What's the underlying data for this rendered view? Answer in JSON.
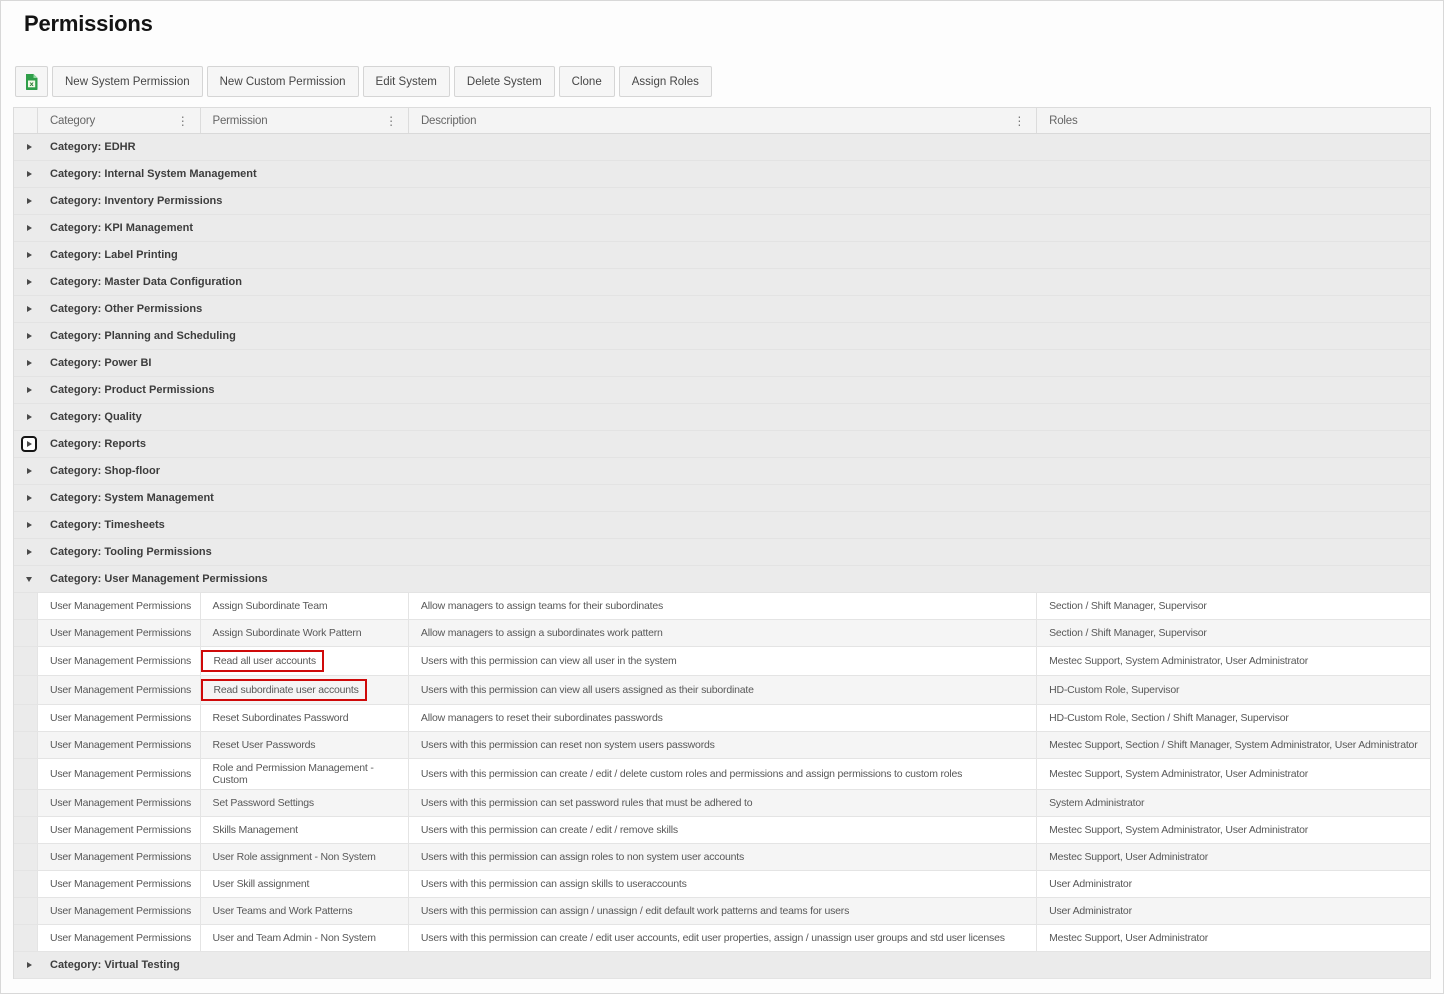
{
  "page": {
    "title": "Permissions"
  },
  "toolbar": {
    "export_icon": "excel-export",
    "buttons": [
      "New System Permission",
      "New Custom Permission",
      "Edit System",
      "Delete System",
      "Clone",
      "Assign Roles"
    ]
  },
  "colors": {
    "highlight_red": "#cf0a0a",
    "excel_green": "#2f9e49",
    "group_row_bg": "#ebebeb",
    "alt_row_bg": "#f5f5f5"
  },
  "grid": {
    "columns": [
      "Category",
      "Permission",
      "Description",
      "Roles"
    ],
    "groups": [
      {
        "label": "Category: EDHR",
        "expanded": false
      },
      {
        "label": "Category: Internal System Management",
        "expanded": false
      },
      {
        "label": "Category: Inventory Permissions",
        "expanded": false
      },
      {
        "label": "Category: KPI Management",
        "expanded": false
      },
      {
        "label": "Category: Label Printing",
        "expanded": false
      },
      {
        "label": "Category: Master Data Configuration",
        "expanded": false
      },
      {
        "label": "Category: Other Permissions",
        "expanded": false
      },
      {
        "label": "Category: Planning and Scheduling",
        "expanded": false
      },
      {
        "label": "Category: Power BI",
        "expanded": false
      },
      {
        "label": "Category: Product Permissions",
        "expanded": false
      },
      {
        "label": "Category: Quality",
        "expanded": false
      },
      {
        "label": "Category: Reports",
        "expanded": false,
        "focused": true
      },
      {
        "label": "Category: Shop-floor",
        "expanded": false
      },
      {
        "label": "Category: System Management",
        "expanded": false
      },
      {
        "label": "Category: Timesheets",
        "expanded": false
      },
      {
        "label": "Category: Tooling Permissions",
        "expanded": false
      },
      {
        "label": "Category: User Management Permissions",
        "expanded": true,
        "rows": [
          {
            "category": "User Management Permissions",
            "permission": "Assign Subordinate Team",
            "highlighted": false,
            "description": "Allow managers to assign teams for their subordinates",
            "roles": "Section / Shift Manager, Supervisor"
          },
          {
            "category": "User Management Permissions",
            "permission": "Assign Subordinate Work Pattern",
            "highlighted": false,
            "description": "Allow managers to assign a subordinates work pattern",
            "roles": "Section / Shift Manager, Supervisor"
          },
          {
            "category": "User Management Permissions",
            "permission": "Read all user accounts",
            "highlighted": true,
            "description": "Users with this permission can view all user in the system",
            "roles": "Mestec Support, System Administrator, User Administrator"
          },
          {
            "category": "User Management Permissions",
            "permission": "Read subordinate user accounts",
            "highlighted": true,
            "description": "Users with this permission can view all users assigned as their subordinate",
            "roles": "HD-Custom Role, Supervisor"
          },
          {
            "category": "User Management Permissions",
            "permission": "Reset Subordinates Password",
            "highlighted": false,
            "description": "Allow managers to reset their subordinates passwords",
            "roles": "HD-Custom Role, Section / Shift Manager, Supervisor"
          },
          {
            "category": "User Management Permissions",
            "permission": "Reset User Passwords",
            "highlighted": false,
            "description": "Users with this permission can reset non system users passwords",
            "roles": "Mestec Support, Section / Shift Manager, System Administrator, User Administrator"
          },
          {
            "category": "User Management Permissions",
            "permission": "Role and Permission Management - Custom",
            "highlighted": false,
            "description": "Users with this permission can create / edit / delete custom roles and permissions and assign permissions to custom roles",
            "roles": "Mestec Support, System Administrator, User Administrator"
          },
          {
            "category": "User Management Permissions",
            "permission": "Set Password Settings",
            "highlighted": false,
            "description": "Users with this permission can set password rules that must be adhered to",
            "roles": "System Administrator"
          },
          {
            "category": "User Management Permissions",
            "permission": "Skills Management",
            "highlighted": false,
            "description": "Users with this permission can create / edit / remove skills",
            "roles": "Mestec Support, System Administrator, User Administrator"
          },
          {
            "category": "User Management Permissions",
            "permission": "User Role assignment - Non System",
            "highlighted": false,
            "description": "Users with this permission can assign roles to non system user accounts",
            "roles": "Mestec Support, User Administrator"
          },
          {
            "category": "User Management Permissions",
            "permission": "User Skill assignment",
            "highlighted": false,
            "description": "Users with this permission can assign skills to useraccounts",
            "roles": "User Administrator"
          },
          {
            "category": "User Management Permissions",
            "permission": "User Teams and Work Patterns",
            "highlighted": false,
            "description": "Users with this permission can assign / unassign / edit default work patterns and teams for users",
            "roles": "User Administrator"
          },
          {
            "category": "User Management Permissions",
            "permission": "User and Team Admin - Non System",
            "highlighted": false,
            "description": "Users with this permission can create / edit user accounts, edit user properties, assign / unassign user groups and std user licenses",
            "roles": "Mestec Support, User Administrator"
          }
        ]
      },
      {
        "label": "Category: Virtual Testing",
        "expanded": false
      }
    ]
  }
}
